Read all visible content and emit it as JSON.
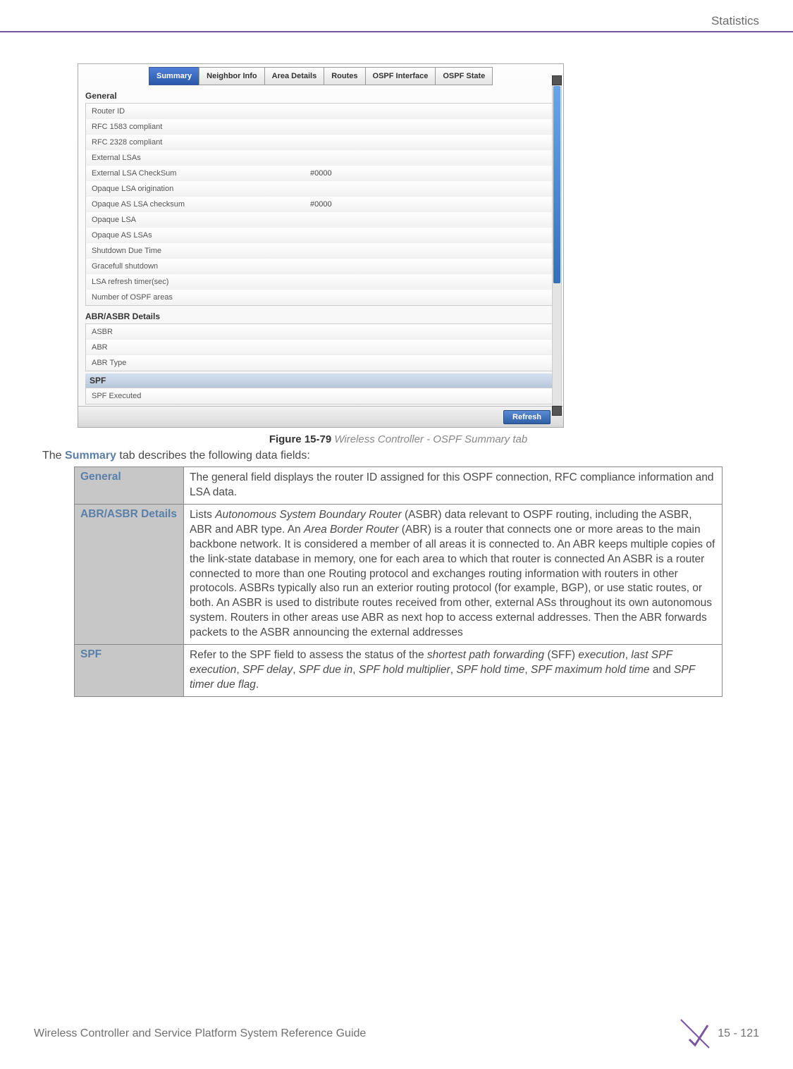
{
  "header": {
    "section": "Statistics"
  },
  "screenshot": {
    "tabs": [
      "Summary",
      "Neighbor Info",
      "Area Details",
      "Routes",
      "OSPF Interface",
      "OSPF State"
    ],
    "active_tab": 0,
    "sections": {
      "general": {
        "title": "General",
        "rows": [
          {
            "label": "Router ID",
            "value": ""
          },
          {
            "label": "RFC 1583 compliant",
            "value": ""
          },
          {
            "label": "RFC 2328 compliant",
            "value": ""
          },
          {
            "label": "External LSAs",
            "value": ""
          },
          {
            "label": "External LSA CheckSum",
            "value": "#0000"
          },
          {
            "label": "Opaque LSA origination",
            "value": ""
          },
          {
            "label": "Opaque AS LSA checksum",
            "value": "#0000"
          },
          {
            "label": "Opaque LSA",
            "value": ""
          },
          {
            "label": "Opaque AS LSAs",
            "value": ""
          },
          {
            "label": "Shutdown Due Time",
            "value": ""
          },
          {
            "label": "Gracefull shutdown",
            "value": ""
          },
          {
            "label": "LSA refresh timer(sec)",
            "value": ""
          },
          {
            "label": "Number of OSPF areas",
            "value": ""
          }
        ]
      },
      "abr": {
        "title": "ABR/ASBR Details",
        "rows": [
          {
            "label": "ASBR",
            "value": ""
          },
          {
            "label": "ABR",
            "value": ""
          },
          {
            "label": "ABR Type",
            "value": ""
          }
        ]
      },
      "spf": {
        "title": "SPF",
        "rows": [
          {
            "label": "SPF Executed",
            "value": ""
          }
        ]
      }
    },
    "refresh_label": "Refresh"
  },
  "figure": {
    "label": "Figure 15-79",
    "title": "Wireless Controller - OSPF Summary tab"
  },
  "intro": {
    "prefix": "The ",
    "bold": "Summary",
    "suffix": " tab describes the following data fields:"
  },
  "table": [
    {
      "label": "General",
      "desc": "The general field displays the router ID assigned for this OSPF connection, RFC compliance information and LSA data."
    },
    {
      "label": "ABR/ASBR Details",
      "desc_parts": [
        {
          "t": "Lists "
        },
        {
          "t": "Autonomous System Boundary Router",
          "i": true
        },
        {
          "t": " (ASBR) data relevant to OSPF routing, including the ASBR, ABR and ABR type. An "
        },
        {
          "t": "Area Border Router",
          "i": true
        },
        {
          "t": " (ABR) is a router that connects one or more areas to the main backbone network. It is considered a member of all areas it is connected to. An ABR keeps multiple copies of the link-state database in memory, one for each area to which that router is connected An ASBR is a router connected to more than one Routing protocol and exchanges routing information with routers in other protocols. ASBRs typically also run an exterior routing protocol (for example, BGP), or use static routes, or both. An ASBR is used to distribute routes received from other, external ASs throughout its own autonomous system. Routers in other areas use ABR as next hop to access external addresses. Then the ABR forwards packets to the ASBR announcing the external addresses"
        }
      ]
    },
    {
      "label": "SPF",
      "desc_parts": [
        {
          "t": "Refer to the SPF field to assess the status of the "
        },
        {
          "t": "shortest path forwarding",
          "i": true
        },
        {
          "t": " (SFF) "
        },
        {
          "t": "execution",
          "i": true
        },
        {
          "t": ", "
        },
        {
          "t": "last SPF execution",
          "i": true
        },
        {
          "t": ", "
        },
        {
          "t": "SPF delay",
          "i": true
        },
        {
          "t": ", "
        },
        {
          "t": "SPF due in",
          "i": true
        },
        {
          "t": ", "
        },
        {
          "t": "SPF hold multiplier",
          "i": true
        },
        {
          "t": ", "
        },
        {
          "t": "SPF hold time",
          "i": true
        },
        {
          "t": ", "
        },
        {
          "t": "SPF maximum hold time",
          "i": true
        },
        {
          "t": " and "
        },
        {
          "t": "SPF timer due flag",
          "i": true
        },
        {
          "t": "."
        }
      ]
    }
  ],
  "footer": {
    "left": "Wireless Controller and Service Platform System Reference Guide",
    "right": "15 - 121"
  }
}
